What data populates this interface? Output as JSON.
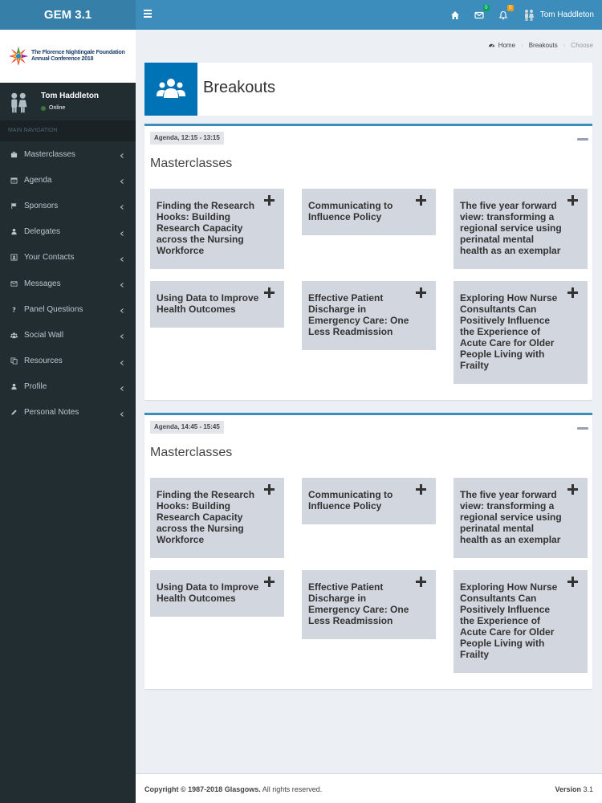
{
  "app": {
    "title": "GEM 3.1"
  },
  "header": {
    "user_name": "Tom Haddleton",
    "mail_count": "0",
    "notif_count": "0"
  },
  "brand": {
    "line1": "The Florence Nightingale Foundation",
    "line2": "Annual Conference 2018"
  },
  "user_panel": {
    "name": "Tom Haddleton",
    "status": "Online"
  },
  "sidebar": {
    "header": "MAIN NAVIGATION",
    "items": [
      {
        "label": "Masterclasses",
        "icon": "briefcase-icon"
      },
      {
        "label": "Agenda",
        "icon": "calendar-icon"
      },
      {
        "label": "Sponsors",
        "icon": "flag-icon"
      },
      {
        "label": "Delegates",
        "icon": "user-icon"
      },
      {
        "label": "Your Contacts",
        "icon": "contact-card-icon"
      },
      {
        "label": "Messages",
        "icon": "envelope-icon"
      },
      {
        "label": "Panel Questions",
        "icon": "question-icon"
      },
      {
        "label": "Social Wall",
        "icon": "users-icon"
      },
      {
        "label": "Resources",
        "icon": "copy-icon"
      },
      {
        "label": "Profile",
        "icon": "user-icon"
      },
      {
        "label": "Personal Notes",
        "icon": "pencil-icon"
      }
    ]
  },
  "breadcrumb": {
    "home": "Home",
    "section": "Breakouts",
    "current": "Choose"
  },
  "page": {
    "title": "Breakouts"
  },
  "sessions": [
    {
      "agenda": "Agenda, 12:15 - 13:15",
      "title": "Masterclasses",
      "cards": [
        "Finding the Research Hooks: Building Research Capacity across the Nursing Workforce",
        "Communicating to Influence Policy",
        "The five year forward view: transforming a regional service using perinatal mental health as an exemplar",
        "Using Data to Improve Health Outcomes",
        "Effective Patient Discharge in Emergency Care: One Less Readmission",
        "Exploring How Nurse Consultants Can Positively Influence the Experience of Acute Care for Older People Living with Frailty"
      ]
    },
    {
      "agenda": "Agenda, 14:45 - 15:45",
      "title": "Masterclasses",
      "cards": [
        "Finding the Research Hooks: Building Research Capacity across the Nursing Workforce",
        "Communicating to Influence Policy",
        "The five year forward view: transforming a regional service using perinatal mental health as an exemplar",
        "Using Data to Improve Health Outcomes",
        "Effective Patient Discharge in Emergency Care: One Less Readmission",
        "Exploring How Nurse Consultants Can Positively Influence the Experience of Acute Care for Older People Living with Frailty"
      ]
    }
  ],
  "footer": {
    "copyright_prefix": "Copyright © 1987-2018",
    "company": "Glasgows.",
    "rights": "All rights reserved.",
    "version_label": "Version",
    "version": "3.1"
  },
  "colors": {
    "header": "#3c8dbc",
    "logo": "#367fa9",
    "sidebar": "#222d32",
    "accent": "#0073b7",
    "card": "#d2d6de"
  }
}
